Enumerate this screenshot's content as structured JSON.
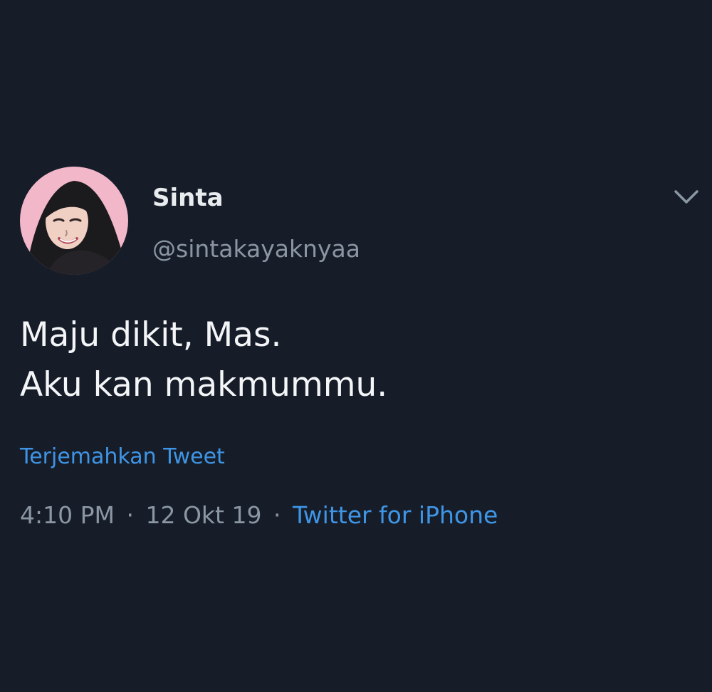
{
  "author": {
    "display_name": "Sinta",
    "handle": "@sintakayaknyaa"
  },
  "tweet": {
    "lines": [
      "Maju dikit, Mas.",
      "Aku kan makmummu."
    ],
    "translate_label": "Terjemahkan Tweet",
    "time": "4:10 PM",
    "date": "12 Okt 19",
    "separator": "·",
    "source": "Twitter for iPhone"
  },
  "colors": {
    "background": "#161d29",
    "primary_text": "#f3f5f7",
    "secondary_text": "#8a96a3",
    "link": "#3f95e5",
    "avatar_background": "#f2b7c8"
  },
  "icons": {
    "menu": "chevron-down-icon"
  }
}
